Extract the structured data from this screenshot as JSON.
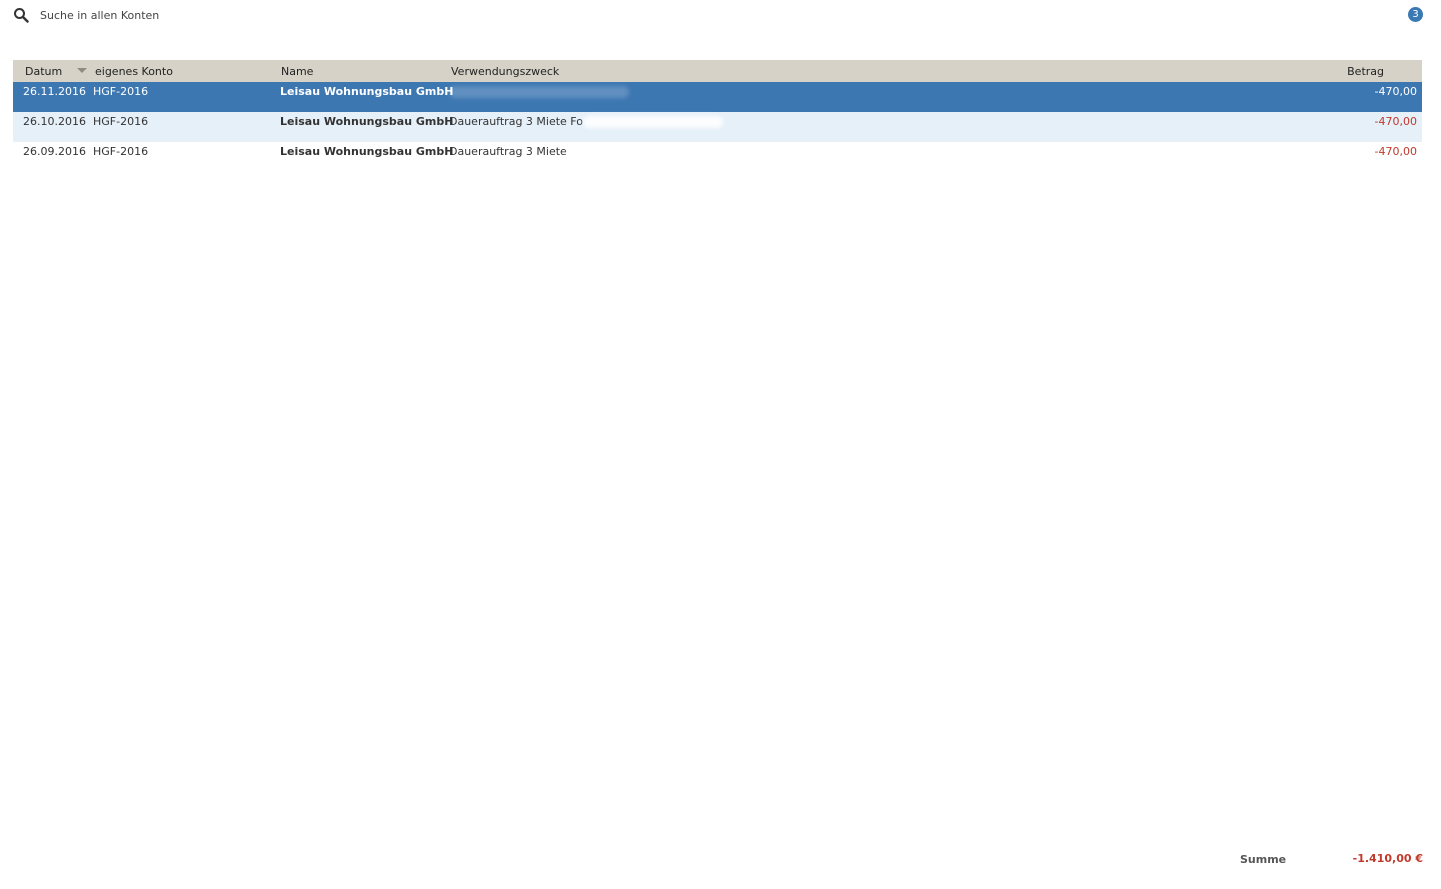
{
  "search": {
    "placeholder": "Suche in allen Konten",
    "result_count": "3"
  },
  "table": {
    "columns": {
      "datum": "Datum",
      "konto": "eigenes Konto",
      "name": "Name",
      "zweck": "Verwendungszweck",
      "betrag": "Betrag"
    },
    "sort": {
      "column": "Datum",
      "direction": "descending"
    },
    "rows": [
      {
        "datum": "26.11.2016",
        "konto": "HGF-2016",
        "name": "Leisau Wohnungsbau GmbH",
        "zweck": "",
        "betrag": "-470,00",
        "selected": true
      },
      {
        "datum": "26.10.2016",
        "konto": "HGF-2016",
        "name": "Leisau Wohnungsbau GmbH",
        "zweck": "Dauerauftrag 3 Miete Fo",
        "betrag": "-470,00",
        "selected": false
      },
      {
        "datum": "26.09.2016",
        "konto": "HGF-2016",
        "name": "Leisau Wohnungsbau GmbH",
        "zweck": "Dauerauftrag 3 Miete",
        "betrag": "-470,00",
        "selected": false
      }
    ]
  },
  "footer": {
    "summe_label": "Summe",
    "summe_value": "-1.410,00 €"
  },
  "colors": {
    "header_bg": "#d6d2c7",
    "selected_row": "#3d77b2",
    "alt_row": "#e6f0f9",
    "negative_amount": "#c0392b",
    "badge": "#3a79b4"
  }
}
